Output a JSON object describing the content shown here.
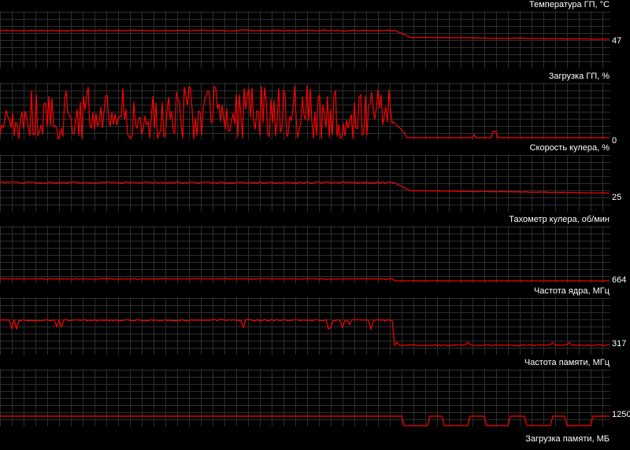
{
  "colors": {
    "background": "#000000",
    "grid": "#2e2e2e",
    "trace": "#ff0000",
    "text": "#ffffff"
  },
  "graphs": [
    {
      "title": "Температура ГП, °C",
      "value": "47"
    },
    {
      "title": "Загрузка ГП, %",
      "value": "0"
    },
    {
      "title": "Скорость кулера, %",
      "value": "25"
    },
    {
      "title": "Тахометр кулера, об/мин",
      "value": "664"
    },
    {
      "title": "Частота ядра, МГц",
      "value": "317"
    },
    {
      "title": "Частота памяти, МГц",
      "value": "1250"
    }
  ],
  "footer": {
    "title": "Загрузка памяти, МБ"
  }
}
